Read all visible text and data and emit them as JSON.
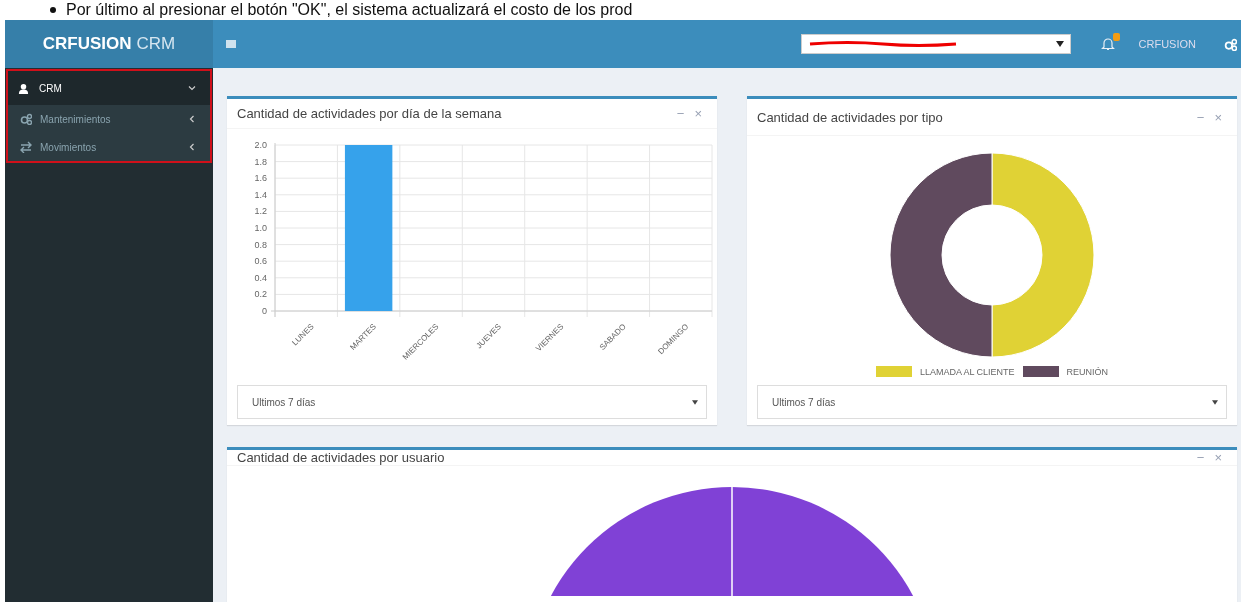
{
  "document_text": "Por último al presionar el botón \"OK\", el sistema actualizará el costo de los prod",
  "header": {
    "brand": "CRFUSION",
    "brand_suffix": "CRM",
    "company_select": {
      "redacted": true
    },
    "notifications": {
      "badge": true
    },
    "user": "CRFUSION"
  },
  "sidebar": {
    "items": [
      {
        "label": "CRM",
        "kind": "user",
        "expanded": true,
        "children": [
          {
            "label": "Mantenimientos",
            "kind": "cogs",
            "expanded": false
          },
          {
            "label": "Movimientos",
            "kind": "exchange",
            "expanded": false
          }
        ]
      }
    ]
  },
  "panels": [
    {
      "title": "Cantidad de actividades por día de la semana",
      "tools": [
        "−",
        "×"
      ],
      "kind": "bar",
      "filter": "Ultimos 7 días",
      "chart_data": {
        "type": "bar",
        "categories": [
          "LUNES",
          "MARTES",
          "MIERCOLES",
          "JUEVES",
          "VIERNES",
          "SABADO",
          "DOMINGO"
        ],
        "series": [
          {
            "color": "#36a2eb",
            "values": [
              0,
              2,
              0,
              0,
              0,
              0,
              0
            ]
          }
        ],
        "grid": true,
        "ylim": [
          0,
          2
        ],
        "yticks": [
          {
            "value": 0,
            "label": "0"
          },
          {
            "value": 0.2,
            "label": "0.2"
          },
          {
            "value": 0.4,
            "label": "0.4"
          },
          {
            "value": 0.6,
            "label": "0.6"
          },
          {
            "value": 0.8,
            "label": "0.8"
          },
          {
            "value": 1,
            "label": "1.0"
          },
          {
            "value": 1.2,
            "label": "1.2"
          },
          {
            "value": 1.4,
            "label": "1.4"
          },
          {
            "value": 1.6,
            "label": "1.6"
          },
          {
            "value": 1.8,
            "label": "1.8"
          },
          {
            "value": 2,
            "label": "2.0"
          }
        ]
      }
    },
    {
      "title": "Cantidad de actividades por tipo",
      "tools": [
        "−",
        "×"
      ],
      "kind": "donut",
      "filter": "Ultimos 7 días",
      "legend": [
        {
          "label": "LLAMADA AL CLIENTE",
          "color": "#e0d235"
        },
        {
          "label": "REUNIÓN",
          "color": "#604a5e"
        }
      ]
    },
    {
      "title": "Cantidad de actividades por usuario",
      "tools": [
        "−",
        "×"
      ],
      "kind": "pie"
    }
  ]
}
